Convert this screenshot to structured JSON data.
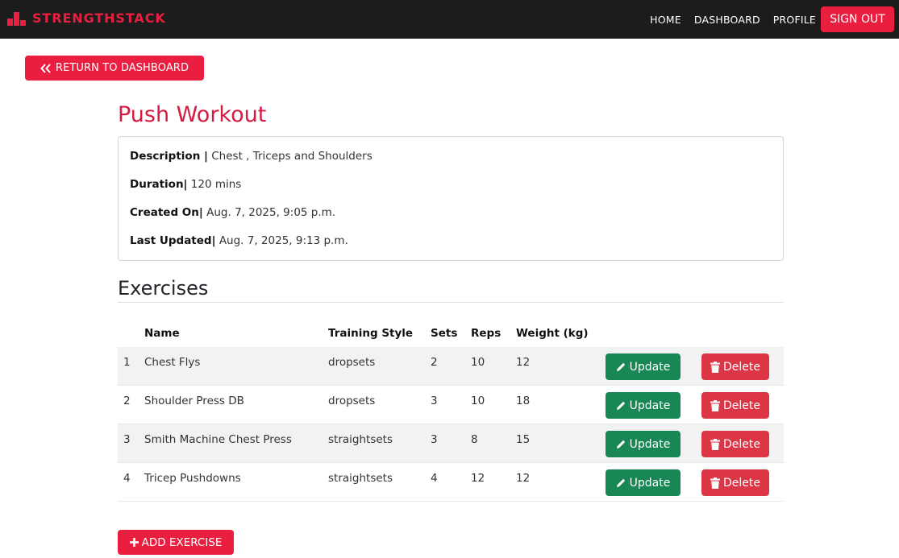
{
  "navbar": {
    "brand": "STRENGTHSTACK",
    "brand_icon": "podium-icon",
    "links": [
      "HOME",
      "DASHBOARD",
      "PROFILE"
    ],
    "signout_label": "SIGN OUT"
  },
  "return_button": {
    "label": "RETURN TO DASHBOARD",
    "icon": "double-chevron-left-icon"
  },
  "workout": {
    "title": "Push Workout",
    "details": [
      {
        "label": "Description |",
        "value": "Chest , Triceps and Shoulders"
      },
      {
        "label": "Duration|",
        "value": "120 mins"
      },
      {
        "label": "Created On|",
        "value": "Aug. 7, 2025, 9:05 p.m."
      },
      {
        "label": "Last Updated|",
        "value": "Aug. 7, 2025, 9:13 p.m."
      }
    ]
  },
  "exercises": {
    "heading": "Exercises",
    "columns": [
      "Name",
      "Training Style",
      "Sets",
      "Reps",
      "Weight (kg)"
    ],
    "update_label": "Update",
    "delete_label": "Delete",
    "rows": [
      {
        "num": "1",
        "name": "Chest Flys",
        "style": "dropsets",
        "sets": "2",
        "reps": "10",
        "weight": "12"
      },
      {
        "num": "2",
        "name": "Shoulder Press DB",
        "style": "dropsets",
        "sets": "3",
        "reps": "10",
        "weight": "18"
      },
      {
        "num": "3",
        "name": "Smith Machine Chest Press",
        "style": "straightsets",
        "sets": "3",
        "reps": "8",
        "weight": "15"
      },
      {
        "num": "4",
        "name": "Tricep Pushdowns",
        "style": "straightsets",
        "sets": "4",
        "reps": "12",
        "weight": "12"
      }
    ]
  },
  "add_button": {
    "label": "ADD EXERCISE",
    "icon": "plus-icon"
  },
  "colors": {
    "brand": "#ea1e3f",
    "title": "#d41c42",
    "navbar_bg": "#1c1c1c",
    "update": "#198754",
    "delete": "#dc3545"
  }
}
